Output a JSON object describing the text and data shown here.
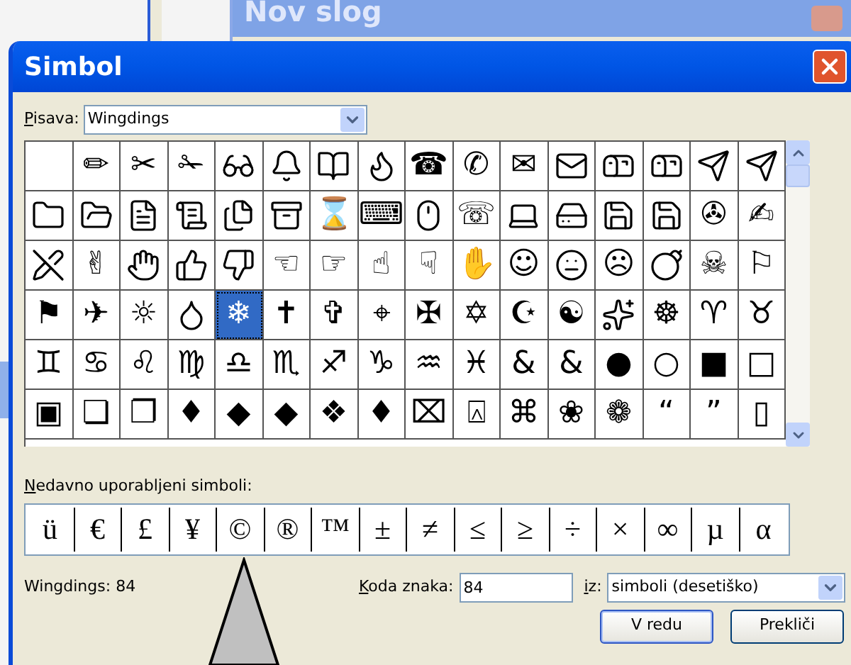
{
  "background_window": {
    "title": "Nov slog"
  },
  "dialog": {
    "title": "Simbol",
    "font_label": "Pisava:",
    "font_value": "Wingdings",
    "grid": {
      "rows": [
        {
          "cells": [
            {
              "kind": "blank",
              "selected": false
            },
            {
              "kind": "char",
              "symbol": "✏",
              "selected": false
            },
            {
              "kind": "char",
              "symbol": "✂",
              "selected": false
            },
            {
              "kind": "char",
              "symbol": "✁",
              "selected": false
            },
            {
              "kind": "icon",
              "selected": false
            },
            {
              "kind": "icon",
              "selected": false
            },
            {
              "kind": "icon",
              "selected": false
            },
            {
              "kind": "icon",
              "selected": false
            },
            {
              "kind": "char",
              "symbol": "☎",
              "selected": false
            },
            {
              "kind": "char",
              "symbol": "✆",
              "selected": false
            },
            {
              "kind": "char",
              "symbol": "✉",
              "selected": false
            },
            {
              "kind": "icon",
              "selected": false
            },
            {
              "kind": "icon",
              "selected": false
            },
            {
              "kind": "icon",
              "selected": false
            },
            {
              "kind": "icon",
              "selected": false
            },
            {
              "kind": "icon",
              "selected": false
            }
          ]
        },
        {
          "cells": [
            {
              "kind": "icon",
              "selected": false
            },
            {
              "kind": "icon",
              "selected": false
            },
            {
              "kind": "icon",
              "selected": false
            },
            {
              "kind": "icon",
              "selected": false
            },
            {
              "kind": "icon",
              "selected": false
            },
            {
              "kind": "icon",
              "selected": false
            },
            {
              "kind": "char",
              "symbol": "⌛",
              "selected": false
            },
            {
              "kind": "char",
              "symbol": "⌨",
              "selected": false
            },
            {
              "kind": "icon",
              "selected": false
            },
            {
              "kind": "char",
              "symbol": "☏",
              "selected": false
            },
            {
              "kind": "icon",
              "selected": false
            },
            {
              "kind": "icon",
              "selected": false
            },
            {
              "kind": "icon",
              "selected": false
            },
            {
              "kind": "icon",
              "selected": false
            },
            {
              "kind": "char",
              "symbol": "✇",
              "selected": false
            },
            {
              "kind": "char",
              "symbol": "✍",
              "selected": false
            }
          ]
        },
        {
          "cells": [
            {
              "kind": "icon",
              "selected": false
            },
            {
              "kind": "char",
              "symbol": "✌",
              "selected": false
            },
            {
              "kind": "icon",
              "selected": false
            },
            {
              "kind": "icon",
              "selected": false
            },
            {
              "kind": "icon",
              "selected": false
            },
            {
              "kind": "char",
              "symbol": "☜",
              "selected": false
            },
            {
              "kind": "char",
              "symbol": "☞",
              "selected": false
            },
            {
              "kind": "char",
              "symbol": "☝",
              "selected": false
            },
            {
              "kind": "char",
              "symbol": "☟",
              "selected": false
            },
            {
              "kind": "char",
              "symbol": "✋",
              "selected": false
            },
            {
              "kind": "char",
              "symbol": "☺",
              "selected": false
            },
            {
              "kind": "icon",
              "selected": false
            },
            {
              "kind": "char",
              "symbol": "☹",
              "selected": false
            },
            {
              "kind": "icon",
              "selected": false
            },
            {
              "kind": "char",
              "symbol": "☠",
              "selected": false
            },
            {
              "kind": "char",
              "symbol": "⚐",
              "selected": false
            }
          ]
        },
        {
          "cells": [
            {
              "kind": "char",
              "symbol": "⚑",
              "selected": false
            },
            {
              "kind": "char",
              "symbol": "✈",
              "selected": false
            },
            {
              "kind": "char",
              "symbol": "☼",
              "selected": false
            },
            {
              "kind": "icon",
              "selected": false
            },
            {
              "kind": "char",
              "symbol": "❄",
              "selected": true
            },
            {
              "kind": "char",
              "symbol": "✝",
              "selected": false
            },
            {
              "kind": "char",
              "symbol": "✞",
              "selected": false
            },
            {
              "kind": "char",
              "symbol": "⌖",
              "selected": false
            },
            {
              "kind": "char",
              "symbol": "✠",
              "selected": false
            },
            {
              "kind": "char",
              "symbol": "✡",
              "selected": false
            },
            {
              "kind": "char",
              "symbol": "☪",
              "selected": false
            },
            {
              "kind": "char",
              "symbol": "☯",
              "selected": false
            },
            {
              "kind": "icon",
              "selected": false
            },
            {
              "kind": "char",
              "symbol": "☸",
              "selected": false
            },
            {
              "kind": "char",
              "symbol": "♈",
              "selected": false
            },
            {
              "kind": "char",
              "symbol": "♉",
              "selected": false
            }
          ]
        },
        {
          "cells": [
            {
              "kind": "char",
              "symbol": "♊",
              "selected": false
            },
            {
              "kind": "char",
              "symbol": "♋",
              "selected": false
            },
            {
              "kind": "char",
              "symbol": "♌",
              "selected": false
            },
            {
              "kind": "char",
              "symbol": "♍",
              "selected": false
            },
            {
              "kind": "char",
              "symbol": "♎",
              "selected": false
            },
            {
              "kind": "char",
              "symbol": "♏",
              "selected": false
            },
            {
              "kind": "char",
              "symbol": "♐",
              "selected": false
            },
            {
              "kind": "char",
              "symbol": "♑",
              "selected": false
            },
            {
              "kind": "char",
              "symbol": "♒",
              "selected": false
            },
            {
              "kind": "char",
              "symbol": "♓",
              "selected": false
            },
            {
              "kind": "char",
              "symbol": "&",
              "selected": false
            },
            {
              "kind": "char",
              "symbol": "&",
              "selected": false
            },
            {
              "kind": "char",
              "symbol": "●",
              "selected": false
            },
            {
              "kind": "char",
              "symbol": "○",
              "selected": false
            },
            {
              "kind": "char",
              "symbol": "■",
              "selected": false
            },
            {
              "kind": "char",
              "symbol": "□",
              "selected": false
            }
          ]
        },
        {
          "cells": [
            {
              "kind": "char",
              "symbol": "▣",
              "selected": false
            },
            {
              "kind": "char",
              "symbol": "❏",
              "selected": false
            },
            {
              "kind": "char",
              "symbol": "❐",
              "selected": false
            },
            {
              "kind": "char",
              "symbol": "♦",
              "selected": false
            },
            {
              "kind": "char",
              "symbol": "◆",
              "selected": false
            },
            {
              "kind": "char",
              "symbol": "◆",
              "selected": false
            },
            {
              "kind": "char",
              "symbol": "❖",
              "selected": false
            },
            {
              "kind": "char",
              "symbol": "♦",
              "selected": false
            },
            {
              "kind": "char",
              "symbol": "⌧",
              "selected": false
            },
            {
              "kind": "char",
              "symbol": "⍓",
              "selected": false
            },
            {
              "kind": "char",
              "symbol": "⌘",
              "selected": false
            },
            {
              "kind": "char",
              "symbol": "❀",
              "selected": false
            },
            {
              "kind": "char",
              "symbol": "❁",
              "selected": false
            },
            {
              "kind": "char",
              "symbol": "“",
              "selected": false
            },
            {
              "kind": "char",
              "symbol": "”",
              "selected": false
            },
            {
              "kind": "char",
              "symbol": "▯",
              "selected": false
            }
          ]
        }
      ]
    },
    "recent_label": "Nedavno uporabljeni simboli:",
    "recent": [
      "ü",
      "€",
      "£",
      "¥",
      "©",
      "®",
      "™",
      "±",
      "≠",
      "≤",
      "≥",
      "÷",
      "×",
      "∞",
      "µ",
      "α"
    ],
    "status": "Wingdings: 84",
    "code_label": "Koda znaka:",
    "code_value": "84",
    "from_label": "iz:",
    "from_value": "simboli (desetiško)",
    "buttons": [
      "V redu",
      "Prekliči"
    ]
  }
}
